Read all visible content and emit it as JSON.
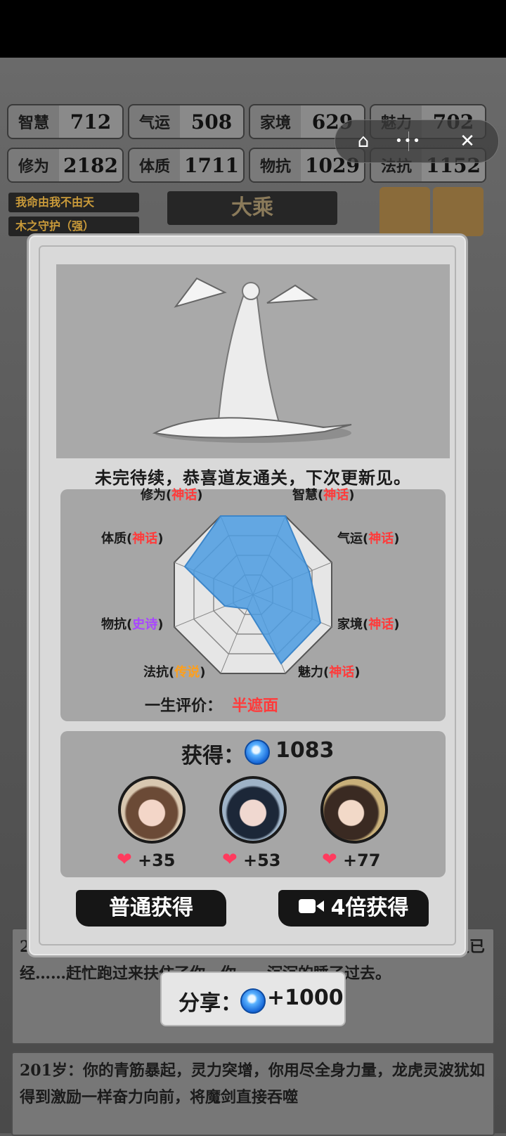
{
  "stats_row1": [
    {
      "key": "智慧",
      "value": "712"
    },
    {
      "key": "气运",
      "value": "508"
    },
    {
      "key": "家境",
      "value": "629"
    },
    {
      "key": "魅力",
      "value": "702"
    }
  ],
  "stats_row2": [
    {
      "key": "修为",
      "value": "2182"
    },
    {
      "key": "体质",
      "value": "1711"
    },
    {
      "key": "物抗",
      "value": "1029"
    },
    {
      "key": "法抗",
      "value": "1152"
    }
  ],
  "capsule": {
    "more": "•••",
    "close": "✕",
    "home": "⌂"
  },
  "tags": [
    "我命由我不由天",
    "木之守护（强）"
  ],
  "rank_title": "大乘",
  "modal": {
    "tagline": "未完待续，恭喜道友通关，下次更新见。",
    "radar_labels": [
      {
        "name": "修为",
        "grade": "神话",
        "cls": "myth"
      },
      {
        "name": "智慧",
        "grade": "神话",
        "cls": "myth"
      },
      {
        "name": "体质",
        "grade": "神话",
        "cls": "myth"
      },
      {
        "name": "气运",
        "grade": "神话",
        "cls": "myth"
      },
      {
        "name": "物抗",
        "grade": "史诗",
        "cls": "epic"
      },
      {
        "name": "家境",
        "grade": "神话",
        "cls": "myth"
      },
      {
        "name": "法抗",
        "grade": "传说",
        "cls": "legend"
      },
      {
        "name": "魅力",
        "grade": "神话",
        "cls": "myth"
      }
    ],
    "evaluation_label": "一生评价：",
    "evaluation_value": "半遮面",
    "obtain_label": "获得：",
    "obtain_amount": "1083",
    "companions": [
      {
        "favor": "+35"
      },
      {
        "favor": "+53"
      },
      {
        "favor": "+77"
      }
    ],
    "normal_button": "普通获得",
    "video_button": "4倍获得"
  },
  "share": {
    "label": "分享：",
    "value": "+1000"
  },
  "logs": [
    "201岁：当一切归于平静，当你确认你成功击杀了三圣，你整个人已经……赶忙跑过来扶住了你，你……沉沉的睡了过去。",
    "201岁：你的青筋暴起，灵力突增，你用尽全身力量，龙虎灵波犹如得到激励一样奋力向前，将魔剑直接吞噬"
  ],
  "colors": {
    "accent": "#ff3b3b",
    "radar_fill": "#4b9be0"
  }
}
